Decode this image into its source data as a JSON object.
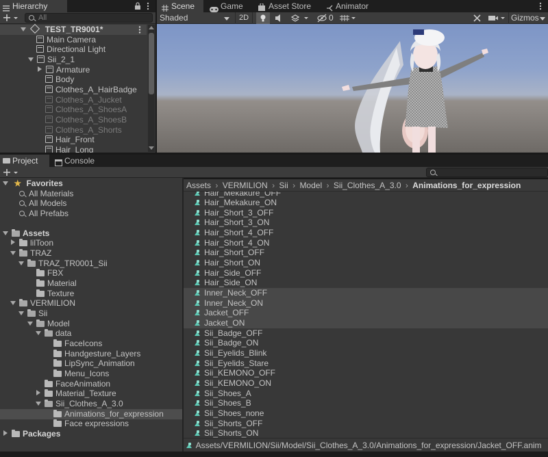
{
  "hierarchy": {
    "tab_label": "Hierarchy",
    "search_placeholder": "All",
    "scene_name": "TEST_TR9001*",
    "items": [
      {
        "label": "Main Camera",
        "dim": false
      },
      {
        "label": "Directional Light",
        "dim": false
      },
      {
        "label": "Sii_2_1",
        "dim": false
      },
      {
        "label": "Armature",
        "dim": false
      },
      {
        "label": "Body",
        "dim": false
      },
      {
        "label": "Clothes_A_HairBadge",
        "dim": false
      },
      {
        "label": "Clothes_A_Jucket",
        "dim": true
      },
      {
        "label": "Clothes_A_ShoesA",
        "dim": true
      },
      {
        "label": "Clothes_A_ShoesB",
        "dim": true
      },
      {
        "label": "Clothes_A_Shorts",
        "dim": true
      },
      {
        "label": "Hair_Front",
        "dim": false
      },
      {
        "label": "Hair_Long",
        "dim": false
      }
    ]
  },
  "scene_tabs": {
    "scene": "Scene",
    "game": "Game",
    "asset_store": "Asset Store",
    "animator": "Animator"
  },
  "scene_toolbar": {
    "shading_mode": "Shaded",
    "mode_2d": "2D",
    "hidden_count": "0",
    "gizmos": "Gizmos"
  },
  "bottom_tabs": {
    "project": "Project",
    "console": "Console"
  },
  "favorites": {
    "title": "Favorites",
    "items": [
      "All Materials",
      "All Models",
      "All Prefabs"
    ]
  },
  "assets_tree": {
    "assets": "Assets",
    "liltoon": "lilToon",
    "traz": "TRAZ",
    "traz_sub": "TRAZ_TR0001_Sii",
    "fbx": "FBX",
    "material": "Material",
    "texture": "Texture",
    "vermilion": "VERMILION",
    "sii": "Sii",
    "model": "Model",
    "data": "data",
    "faceicons": "FaceIcons",
    "handgesture": "Handgesture_Layers",
    "lipsync": "LipSync_Animation",
    "menu_icons": "Menu_Icons",
    "faceanimation": "FaceAnimation",
    "material_texture": "Material_Texture",
    "sii_clothes": "Sii_Clothes_A_3.0",
    "anims_for_expression": "Animations_for_expression",
    "face_expressions": "Face expressions",
    "packages": "Packages"
  },
  "breadcrumb": [
    "Assets",
    "VERMILION",
    "Sii",
    "Model",
    "Sii_Clothes_A_3.0",
    "Animations_for_expression"
  ],
  "files": [
    {
      "label": "Hair_Mekakure_OFF",
      "hl": false
    },
    {
      "label": "Hair_Mekakure_ON",
      "hl": false
    },
    {
      "label": "Hair_Short_3_OFF",
      "hl": false
    },
    {
      "label": "Hair_Short_3_ON",
      "hl": false
    },
    {
      "label": "Hair_Short_4_OFF",
      "hl": false
    },
    {
      "label": "Hair_Short_4_ON",
      "hl": false
    },
    {
      "label": "Hair_Short_OFF",
      "hl": false
    },
    {
      "label": "Hair_Short_ON",
      "hl": false
    },
    {
      "label": "Hair_Side_OFF",
      "hl": false
    },
    {
      "label": "Hair_Side_ON",
      "hl": false
    },
    {
      "label": "Inner_Neck_OFF",
      "hl": true
    },
    {
      "label": "Inner_Neck_ON",
      "hl": true
    },
    {
      "label": "Jacket_OFF",
      "hl": true
    },
    {
      "label": "Jacket_ON",
      "hl": true
    },
    {
      "label": "Sii_Badge_OFF",
      "hl": false
    },
    {
      "label": "Sii_Badge_ON",
      "hl": false
    },
    {
      "label": "Sii_Eyelids_Blink",
      "hl": false
    },
    {
      "label": "Sii_Eyelids_Stare",
      "hl": false
    },
    {
      "label": "Sii_KEMONO_OFF",
      "hl": false
    },
    {
      "label": "Sii_KEMONO_ON",
      "hl": false
    },
    {
      "label": "Sii_Shoes_A",
      "hl": false
    },
    {
      "label": "Sii_Shoes_B",
      "hl": false
    },
    {
      "label": "Sii_Shoes_none",
      "hl": false
    },
    {
      "label": "Sii_Shorts_OFF",
      "hl": false
    },
    {
      "label": "Sii_Shorts_ON",
      "hl": false
    }
  ],
  "status_path": "Assets/VERMILION/Sii/Model/Sii_Clothes_A_3.0/Animations_for_expression/Jacket_OFF.anim"
}
